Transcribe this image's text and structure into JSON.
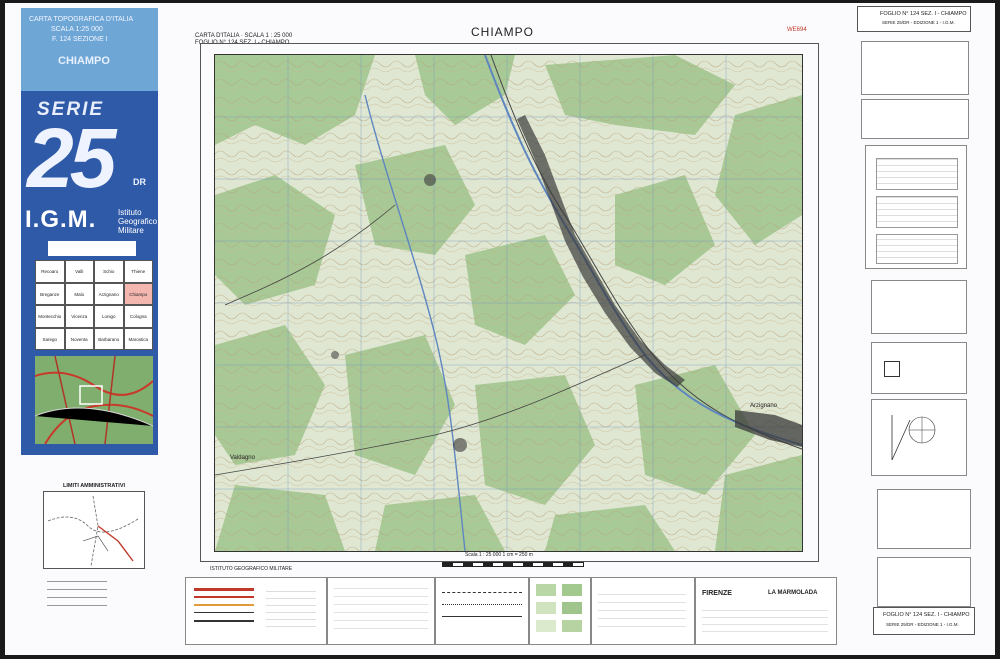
{
  "sheet": {
    "title": "CHIAMPO",
    "header_line1": "CARTA D'ITALIA · SCALA 1 : 25 000",
    "header_line2": "FOGLIO N° 124 SEZ. I - CHIAMPO",
    "code_right": "WE694"
  },
  "cover": {
    "line1": "CARTA TOPOGRAFICA D'ITALIA",
    "line2": "SCALA 1:25 000",
    "line3": "F. 124 SEZIONE I",
    "name": "CHIAMPO",
    "serie_label": "SERIE",
    "serie_number": "25",
    "serie_suffix": "DR",
    "igm": "I.G.M.",
    "igm_full_1": "Istituto",
    "igm_full_2": "Geografico",
    "igm_full_3": "Militare"
  },
  "index_grid": {
    "cells": [
      "Recoaro",
      "Valli",
      "Schio",
      "Thiene",
      "Breganze",
      "Malo",
      "Arzignano",
      "Chiampo",
      "Montecchio",
      "Vicenza",
      "Lonigo",
      "Cologna",
      "Sarego",
      "Noventa",
      "Barbarano",
      "Marostica"
    ]
  },
  "right_panel": {
    "title_box_line1": "FOGLIO N° 124 SEZ. I - CHIAMPO",
    "title_box_line2": "SERIE 25/DR - EDIZIONE 1 - I.G.M.",
    "footer_box_line1": "FOGLIO N° 124 SEZ. I - CHIAMPO",
    "footer_box_line2": "SERIE 25/DR - EDIZIONE 1 - I.G.M."
  },
  "bottom": {
    "limits_title": "LIMITI AMMINISTRATIVI",
    "institute_note": "ISTITUTO GEOGRAFICO MILITARE",
    "scale_text": "Scala 1 : 25 000   1 cm = 250 m",
    "places": [
      "FIRENZE",
      "LA MARMOLADA"
    ]
  },
  "map_labels": {
    "town_sw": "Valdagno",
    "town_se": "Arzignano"
  },
  "colors": {
    "panel_blue": "#2f5aa8",
    "panel_light_blue": "#6ea6d6",
    "map_green": "#9fc48c",
    "river_blue": "#5e86c0"
  }
}
